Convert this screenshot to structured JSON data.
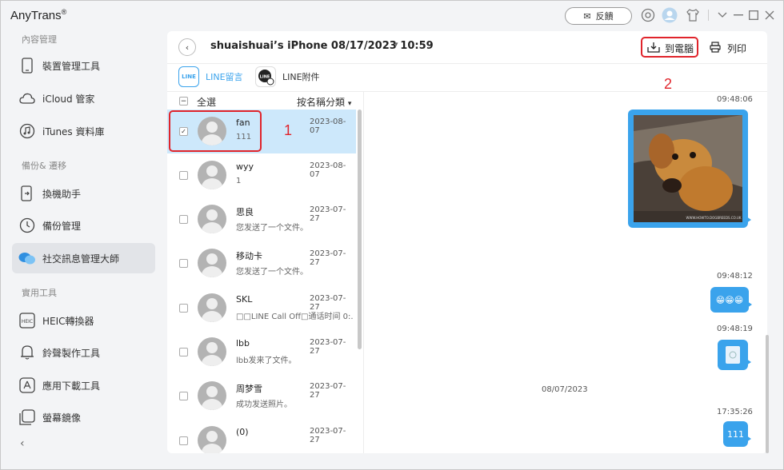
{
  "app": {
    "name": "AnyTrans",
    "mark": "®"
  },
  "titlebar": {
    "feedback_label": "反饋"
  },
  "sidebar": {
    "sections": [
      {
        "label": "內容管理"
      },
      {
        "label": "備份& 遷移"
      },
      {
        "label": "實用工具"
      }
    ],
    "items": [
      {
        "label": "裝置管理工具",
        "icon": "phone-icon"
      },
      {
        "label": "iCloud 管家",
        "icon": "cloud-icon"
      },
      {
        "label": "iTunes 資料庫",
        "icon": "music-icon"
      },
      {
        "label": "換機助手",
        "icon": "phone-transfer-icon"
      },
      {
        "label": "備份管理",
        "icon": "history-icon"
      },
      {
        "label": "社交訊息管理大師",
        "icon": "chat-bubbles-icon"
      },
      {
        "label": "HEIC轉換器",
        "icon": "heic-icon"
      },
      {
        "label": "鈴聲製作工具",
        "icon": "bell-icon"
      },
      {
        "label": "應用下載工具",
        "icon": "app-store-icon"
      },
      {
        "label": "螢幕鏡像",
        "icon": "screen-mirror-icon"
      }
    ]
  },
  "header": {
    "device_title": "shuaishuai’s iPhone 08/17/2023 10:59",
    "to_pc_label": "到電腦",
    "print_label": "列印"
  },
  "tabs": [
    {
      "label": "LINE留言",
      "icon_text": "LINE"
    },
    {
      "label": "LINE附件",
      "icon_text": "LINE"
    }
  ],
  "list": {
    "select_all": "全選",
    "sort_label": "按名稱分類",
    "rows": [
      {
        "name": "fan",
        "date": "2023-08-07",
        "preview": "111",
        "selected": true
      },
      {
        "name": "wyy",
        "date": "2023-08-07",
        "preview": "1",
        "selected": false
      },
      {
        "name": "思良",
        "date": "2023-07-27",
        "preview": "您发送了一个文件。",
        "selected": false
      },
      {
        "name": "移动卡",
        "date": "2023-07-27",
        "preview": "您发送了一个文件。",
        "selected": false
      },
      {
        "name": "SKL",
        "date": "2023-07-27",
        "preview": "□□LINE Call Off□通话时间 0:...",
        "selected": false
      },
      {
        "name": "lbb",
        "date": "2023-07-27",
        "preview": "lbb发来了文件。",
        "selected": false
      },
      {
        "name": "周梦雪",
        "date": "2023-07-27",
        "preview": "成功发送照片。",
        "selected": false
      },
      {
        "name": "(0)",
        "date": "2023-07-27",
        "preview": "",
        "selected": false
      }
    ]
  },
  "chat": {
    "times": [
      "09:48:06",
      "09:48:12",
      "09:48:19",
      "17:35:26"
    ],
    "date_separator": "08/07/2023",
    "photo_watermark": "WWW.HOWTO.DOGBREEDS.CO.UK",
    "emoji_text": "😁😁😁",
    "last_message": "111"
  },
  "annotations": {
    "step1": "1",
    "step2": "2"
  },
  "colors": {
    "accent": "#3aa3ec",
    "highlight": "#e0242b",
    "selected_row": "#cde8fb"
  }
}
